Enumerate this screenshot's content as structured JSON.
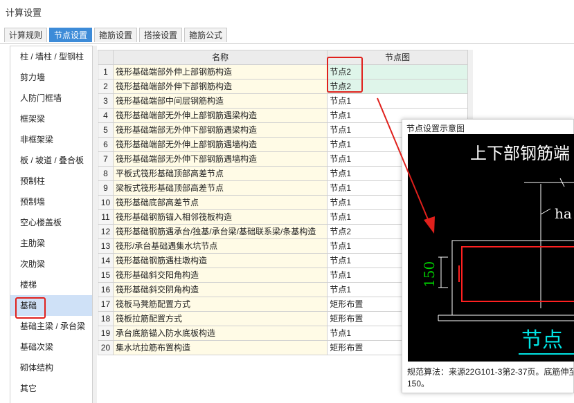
{
  "window": {
    "title": "计算设置"
  },
  "tabs": [
    {
      "label": "计算规则",
      "active": false
    },
    {
      "label": "节点设置",
      "active": true
    },
    {
      "label": "箍筋设置",
      "active": false
    },
    {
      "label": "搭接设置",
      "active": false
    },
    {
      "label": "箍筋公式",
      "active": false
    }
  ],
  "sidebar": {
    "selected": "基础",
    "items": [
      {
        "label": "柱 / 墙柱 / 型钢柱"
      },
      {
        "label": "剪力墙"
      },
      {
        "label": "人防门框墙"
      },
      {
        "label": "框架梁"
      },
      {
        "label": "非框架梁"
      },
      {
        "label": "板 / 坡道 / 叠合板"
      },
      {
        "label": "预制柱"
      },
      {
        "label": "预制墙"
      },
      {
        "label": "空心楼盖板"
      },
      {
        "label": "主肋梁"
      },
      {
        "label": "次肋梁"
      },
      {
        "label": "楼梯"
      },
      {
        "label": "基础"
      },
      {
        "label": "基础主梁 / 承台梁"
      },
      {
        "label": "基础次梁"
      },
      {
        "label": "砌体结构"
      },
      {
        "label": "其它"
      }
    ]
  },
  "grid": {
    "headers": {
      "name": "名称",
      "node": "节点图"
    },
    "rows": [
      {
        "no": "1",
        "name": "筏形基础端部外伸上部钢筋构造",
        "node": "节点2"
      },
      {
        "no": "2",
        "name": "筏形基础端部外伸下部钢筋构造",
        "node": "节点2"
      },
      {
        "no": "3",
        "name": "筏形基础端部中间层钢筋构造",
        "node": "节点1"
      },
      {
        "no": "4",
        "name": "筏形基础端部无外伸上部钢筋遇梁构造",
        "node": "节点1"
      },
      {
        "no": "5",
        "name": "筏形基础端部无外伸下部钢筋遇梁构造",
        "node": "节点1"
      },
      {
        "no": "6",
        "name": "筏形基础端部无外伸上部钢筋遇墙构造",
        "node": "节点1"
      },
      {
        "no": "7",
        "name": "筏形基础端部无外伸下部钢筋遇墙构造",
        "node": "节点1"
      },
      {
        "no": "8",
        "name": "平板式筏形基础顶部高差节点",
        "node": "节点1"
      },
      {
        "no": "9",
        "name": "梁板式筏形基础顶部高差节点",
        "node": "节点1"
      },
      {
        "no": "10",
        "name": "筏形基础底部高差节点",
        "node": "节点1"
      },
      {
        "no": "11",
        "name": "筏形基础钢筋锚入相邻筏板构造",
        "node": "节点1"
      },
      {
        "no": "12",
        "name": "筏形基础钢筋遇承台/独基/承台梁/基础联系梁/条基构造",
        "node": "节点2"
      },
      {
        "no": "13",
        "name": "筏形/承台基础遇集水坑节点",
        "node": "节点1"
      },
      {
        "no": "14",
        "name": "筏形基础钢筋遇柱墩构造",
        "node": "节点1"
      },
      {
        "no": "15",
        "name": "筏形基础斜交阳角构造",
        "node": "节点1"
      },
      {
        "no": "16",
        "name": "筏形基础斜交阴角构造",
        "node": "节点1"
      },
      {
        "no": "17",
        "name": "筏板马凳筋配置方式",
        "node": "矩形布置"
      },
      {
        "no": "18",
        "name": "筏板拉筋配置方式",
        "node": "矩形布置"
      },
      {
        "no": "19",
        "name": "承台底筋锚入防水底板构造",
        "node": "节点1"
      },
      {
        "no": "20",
        "name": "集水坑拉筋布置构造",
        "node": "矩形布置"
      }
    ]
  },
  "preview": {
    "title": "节点设置示意图",
    "diagram": {
      "heading": "上下部钢筋端",
      "dim_label": "ha",
      "dim_value": "150",
      "caption": "节点"
    },
    "note_line1": "规范算法：来源22G101-3第2-37页。底筋伸至",
    "note_line2": "150。"
  },
  "colors": {
    "accent": "#3d8bd8",
    "highlight_red": "#e0201c",
    "cad_white": "#ffffff",
    "cad_red": "#ff2020",
    "cad_green": "#00d000",
    "cad_cyan": "#00e5e5"
  }
}
